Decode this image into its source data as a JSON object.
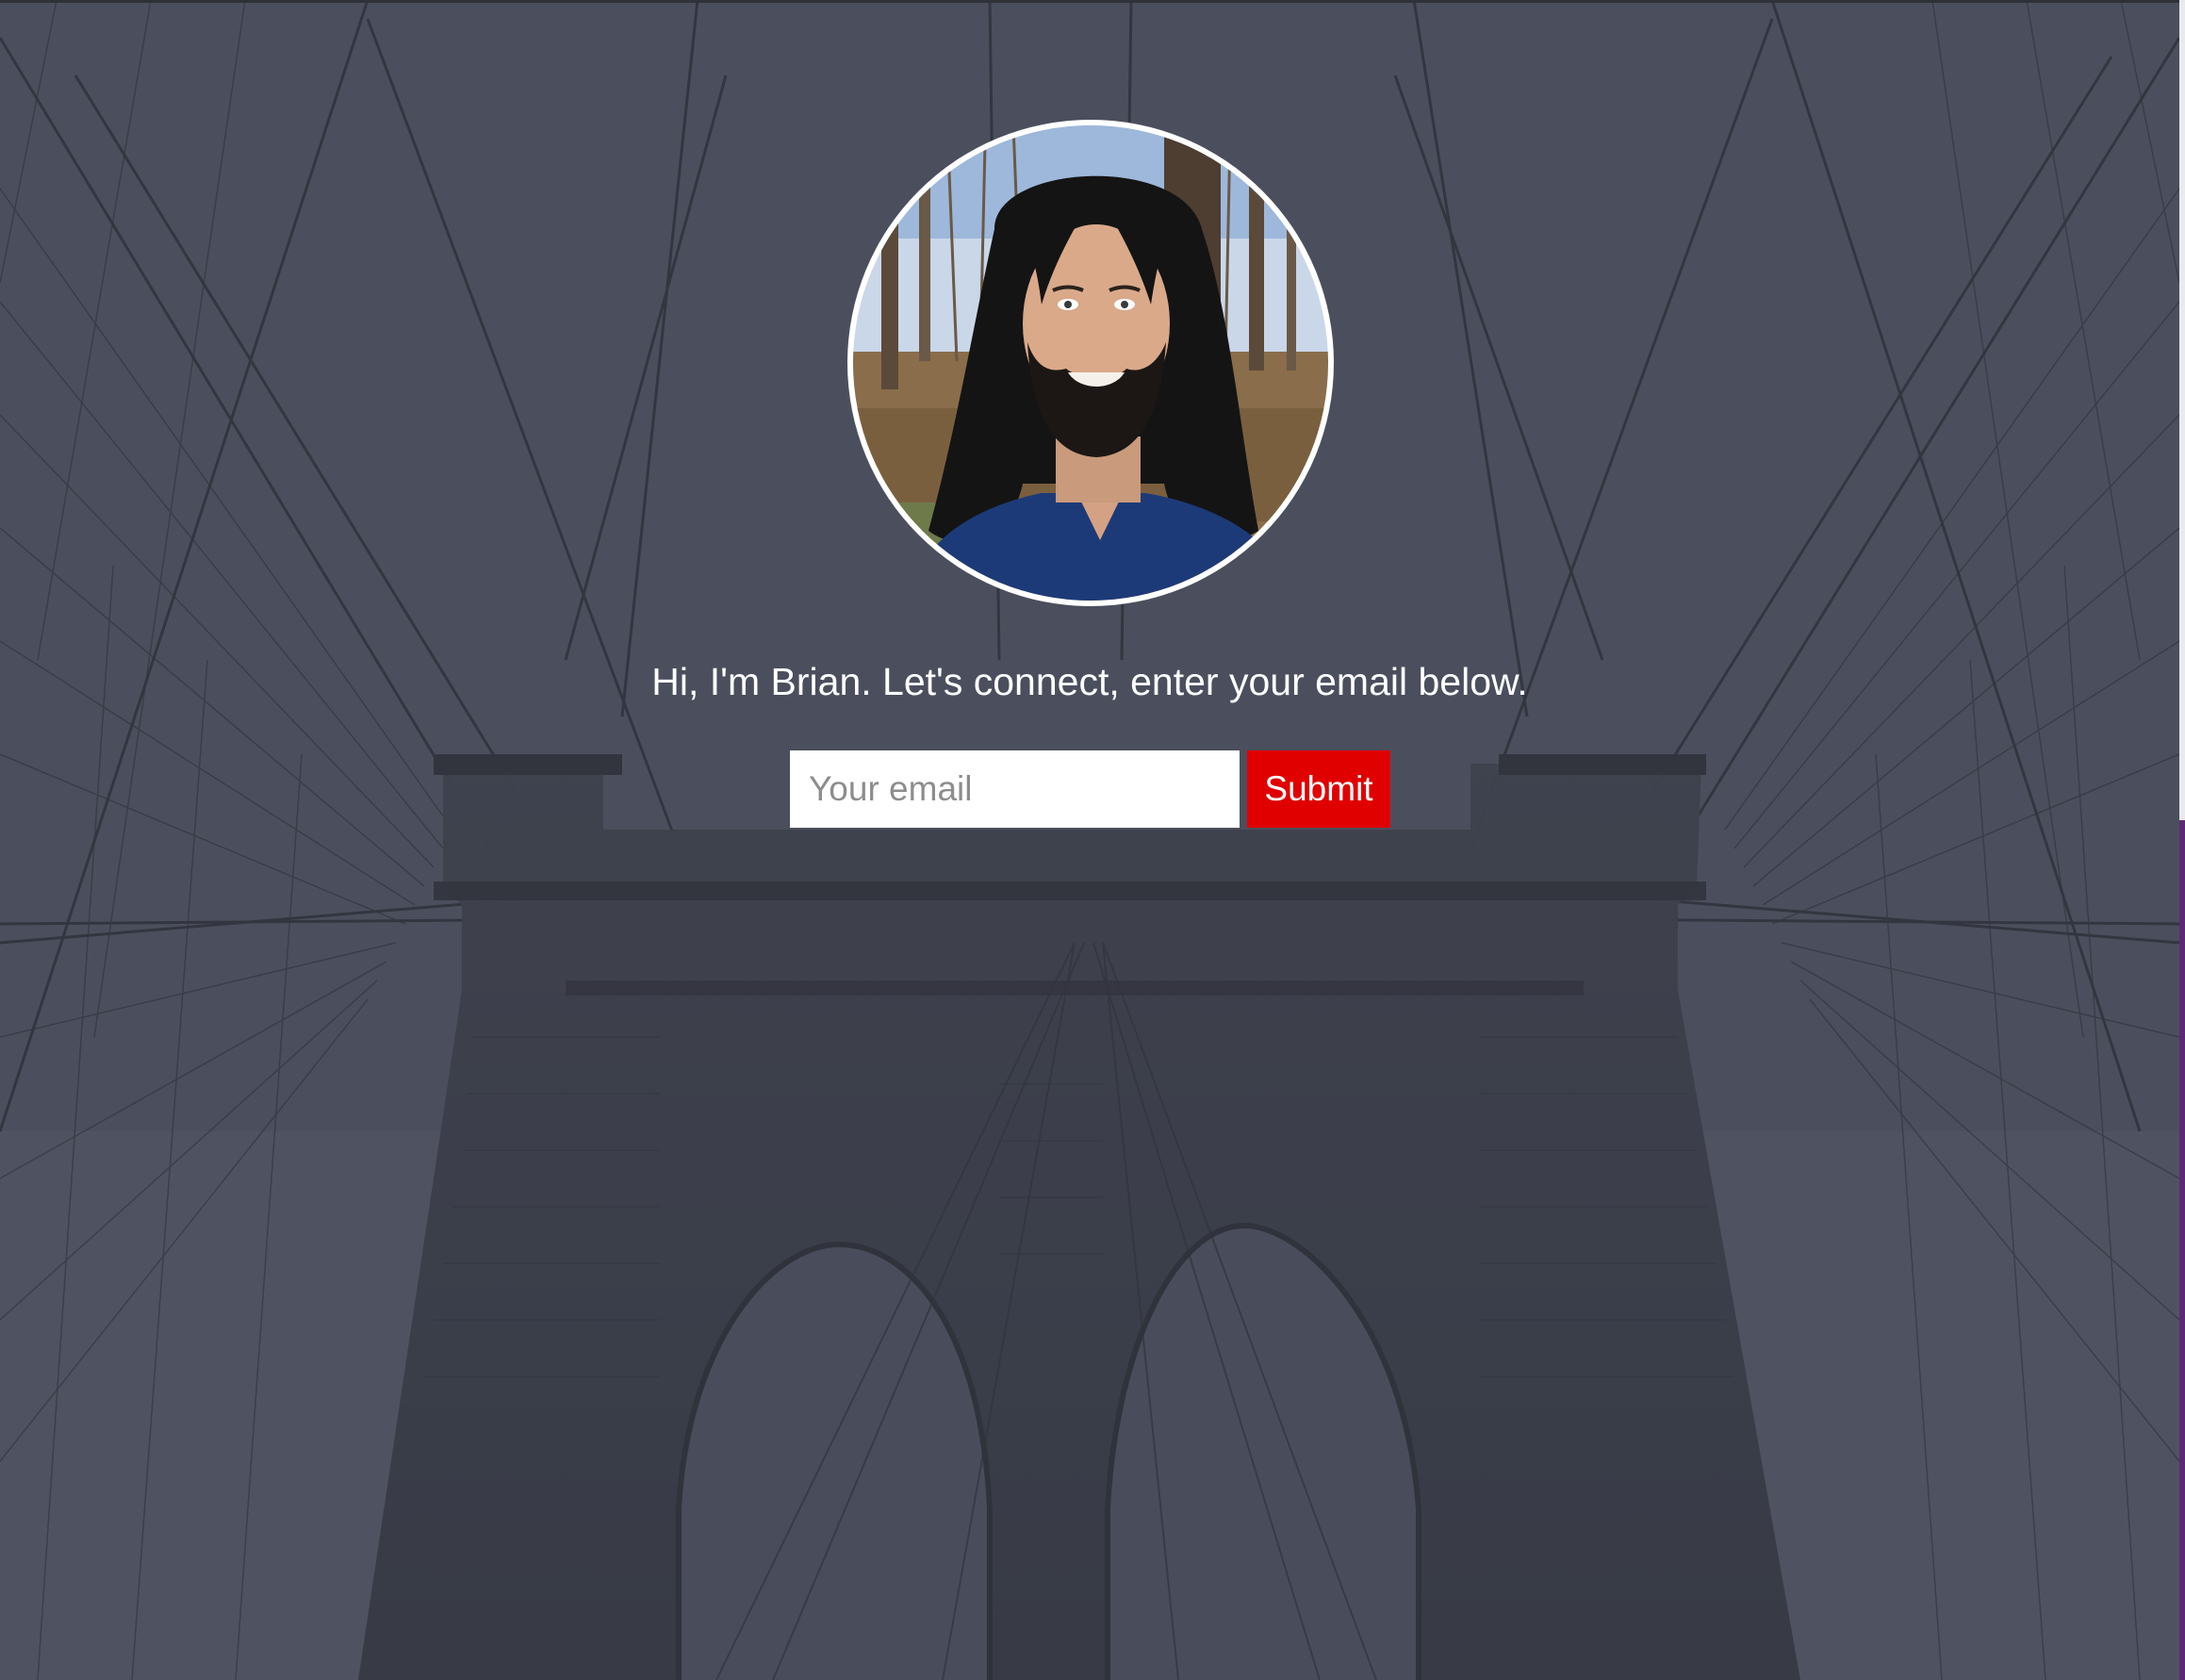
{
  "hero": {
    "intro_text": "Hi, I'm Brian. Let's connect, enter your email below.",
    "avatar_alt": "Brian profile photo"
  },
  "signup_form": {
    "email_placeholder": "Your email",
    "email_value": "",
    "submit_label": "Submit"
  },
  "colors": {
    "overlay": "#4b4f5c",
    "submit_button": "#e00000",
    "text": "#ffffff"
  }
}
